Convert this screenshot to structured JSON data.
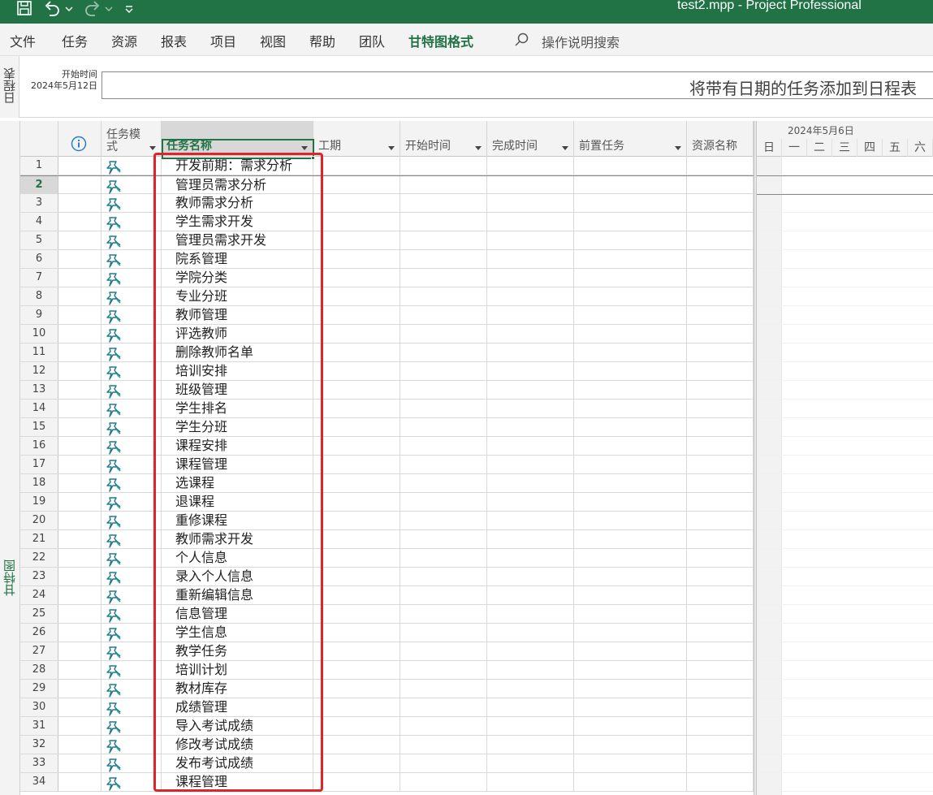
{
  "titlebar": {
    "title": "test2.mpp  -  Project Professional",
    "icons": [
      "save-icon",
      "undo-icon",
      "redo-icon",
      "customize-quick-access-icon"
    ]
  },
  "menu": {
    "items": [
      "文件",
      "任务",
      "资源",
      "报表",
      "项目",
      "视图",
      "帮助",
      "团队",
      "甘特图格式"
    ],
    "active": "甘特图格式",
    "search_hint": "操作说明搜索"
  },
  "timeline": {
    "side_label": "日程表",
    "start_label": "开始时间",
    "start_date": "2024年5月12日",
    "placeholder": "将带有日期的任务添加到日程表"
  },
  "view": {
    "side_label": "甘特图"
  },
  "grid": {
    "headers": {
      "indicators": "info-icon",
      "mode": "任务模\n式",
      "name": "任务名称",
      "duration": "工期",
      "start": "开始时间",
      "finish": "完成时间",
      "predecessors": "前置任务",
      "resources": "资源名称"
    },
    "selected_row": 2,
    "rows": [
      {
        "id": "1",
        "name": "开发前期：需求分析"
      },
      {
        "id": "2",
        "name": "管理员需求分析"
      },
      {
        "id": "3",
        "name": "教师需求分析"
      },
      {
        "id": "4",
        "name": "学生需求开发"
      },
      {
        "id": "5",
        "name": "管理员需求开发"
      },
      {
        "id": "6",
        "name": "院系管理"
      },
      {
        "id": "7",
        "name": "学院分类"
      },
      {
        "id": "8",
        "name": "专业分班"
      },
      {
        "id": "9",
        "name": "教师管理"
      },
      {
        "id": "10",
        "name": "评选教师"
      },
      {
        "id": "11",
        "name": "删除教师名单"
      },
      {
        "id": "12",
        "name": "培训安排"
      },
      {
        "id": "13",
        "name": "班级管理"
      },
      {
        "id": "14",
        "name": "学生排名"
      },
      {
        "id": "15",
        "name": "学生分班"
      },
      {
        "id": "16",
        "name": "课程安排"
      },
      {
        "id": "17",
        "name": "课程管理"
      },
      {
        "id": "18",
        "name": "选课程"
      },
      {
        "id": "19",
        "name": "退课程"
      },
      {
        "id": "20",
        "name": "重修课程"
      },
      {
        "id": "21",
        "name": "教师需求开发"
      },
      {
        "id": "22",
        "name": "个人信息"
      },
      {
        "id": "23",
        "name": "录入个人信息"
      },
      {
        "id": "24",
        "name": "重新编辑信息"
      },
      {
        "id": "25",
        "name": "信息管理"
      },
      {
        "id": "26",
        "name": "学生信息"
      },
      {
        "id": "27",
        "name": "教学任务"
      },
      {
        "id": "28",
        "name": "培训计划"
      },
      {
        "id": "29",
        "name": "教材库存"
      },
      {
        "id": "30",
        "name": "成绩管理"
      },
      {
        "id": "31",
        "name": "导入考试成绩"
      },
      {
        "id": "32",
        "name": "修改考试成绩"
      },
      {
        "id": "33",
        "name": "发布考试成绩"
      },
      {
        "id": "34",
        "name": "课程管理"
      }
    ],
    "mode_icon": "manually-scheduled-pin-icon"
  },
  "chart": {
    "week_label": "2024年5月6日",
    "days": [
      "日",
      "一",
      "二",
      "三",
      "四",
      "五",
      "六"
    ]
  },
  "colors": {
    "accent": "#217346",
    "highlight_box": "#e0242a"
  }
}
